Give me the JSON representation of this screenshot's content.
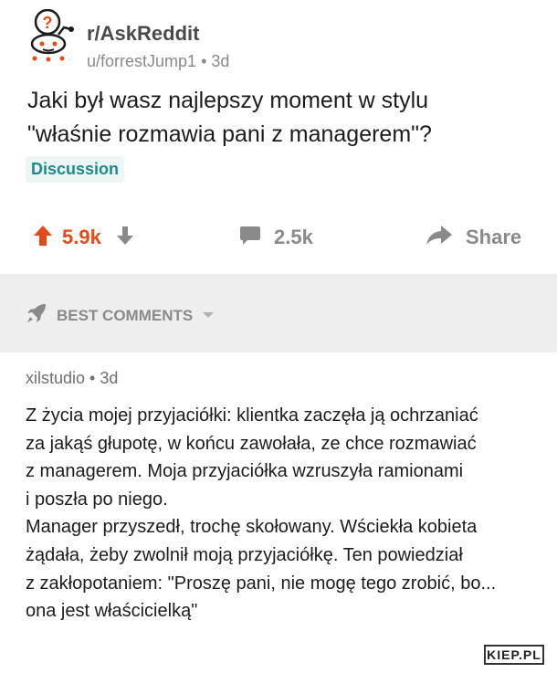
{
  "post": {
    "subreddit": "r/AskReddit",
    "author": "u/forrestJump1",
    "age": "3d",
    "title_lines": [
      "Jaki był wasz najlepszy moment w stylu",
      "\"właśnie rozmawia pani z managerem\"?"
    ],
    "flair": "Discussion"
  },
  "actions": {
    "score": "5.9k",
    "comments": "2.5k",
    "share_label": "Share"
  },
  "sort": {
    "label": "BEST COMMENTS"
  },
  "comment": {
    "author": "xilstudio",
    "age": "3d",
    "lines": [
      "Z życia mojej przyjaciółki: klientka zaczęła ją ochrzaniać",
      "za jakąś głupotę, w końcu zawołała, ze chce rozmawiać",
      "z managerem. Moja przyjaciółka wzruszyła ramionami",
      "i poszła po niego.",
      "Manager przyszedł, trochę skołowany. Wściekła kobieta",
      "żądała, żeby zwolnił moją przyjaciółkę. Ten powiedział",
      "z zakłopotaniem: \"Proszę pani, nie mogę tego zrobić, bo...",
      "ona jest właścicielką\""
    ]
  },
  "watermark": "KIEP.PL",
  "colors": {
    "upvote": "#e64a19",
    "flair_text": "#1d8b8b",
    "flair_bg": "#eef5f5",
    "muted": "#8a8a8a",
    "band": "#eeeeee"
  }
}
